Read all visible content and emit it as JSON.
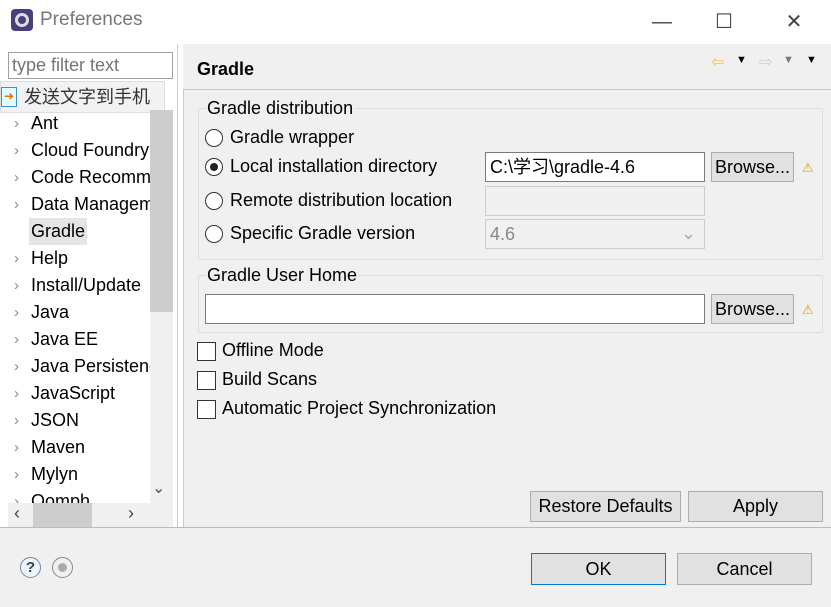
{
  "window": {
    "title": "Preferences",
    "minimize": "—",
    "maximize": "☐",
    "close": "✕"
  },
  "filter": {
    "placeholder": "type filter text"
  },
  "popup": {
    "label": "发送文字到手机"
  },
  "tree": {
    "items": [
      {
        "label": "Ant",
        "expandable": true
      },
      {
        "label": "Cloud Foundry",
        "expandable": true
      },
      {
        "label": "Code Recommenders",
        "expandable": true
      },
      {
        "label": "Data Management",
        "expandable": true
      },
      {
        "label": "Gradle",
        "expandable": false,
        "selected": true
      },
      {
        "label": "Help",
        "expandable": true
      },
      {
        "label": "Install/Update",
        "expandable": true
      },
      {
        "label": "Java",
        "expandable": true
      },
      {
        "label": "Java EE",
        "expandable": true
      },
      {
        "label": "Java Persistence",
        "expandable": true
      },
      {
        "label": "JavaScript",
        "expandable": true
      },
      {
        "label": "JSON",
        "expandable": true
      },
      {
        "label": "Maven",
        "expandable": true
      },
      {
        "label": "Mylyn",
        "expandable": true
      },
      {
        "label": "Oomph",
        "expandable": true
      }
    ]
  },
  "page": {
    "title": "Gradle"
  },
  "distribution": {
    "title": "Gradle distribution",
    "options": [
      {
        "label": "Gradle wrapper",
        "selected": false
      },
      {
        "label": "Local installation directory",
        "selected": true
      },
      {
        "label": "Remote distribution location",
        "selected": false
      },
      {
        "label": "Specific Gradle version",
        "selected": false
      }
    ],
    "local_dir_value": "C:\\学习\\gradle-4.6",
    "remote_value": "",
    "version_value": "4.6",
    "browse": "Browse..."
  },
  "user_home": {
    "title": "Gradle User Home",
    "value": "",
    "browse": "Browse..."
  },
  "checkboxes": [
    {
      "label": "Offline Mode",
      "checked": false
    },
    {
      "label": "Build Scans",
      "checked": false
    },
    {
      "label": "Automatic Project Synchronization",
      "checked": false
    }
  ],
  "buttons": {
    "restore": "Restore Defaults",
    "apply": "Apply",
    "ok": "OK",
    "cancel": "Cancel"
  },
  "colors": {
    "accent": "#0078d7",
    "warning": "#e0a000",
    "back_arrow": "#f5c542"
  }
}
